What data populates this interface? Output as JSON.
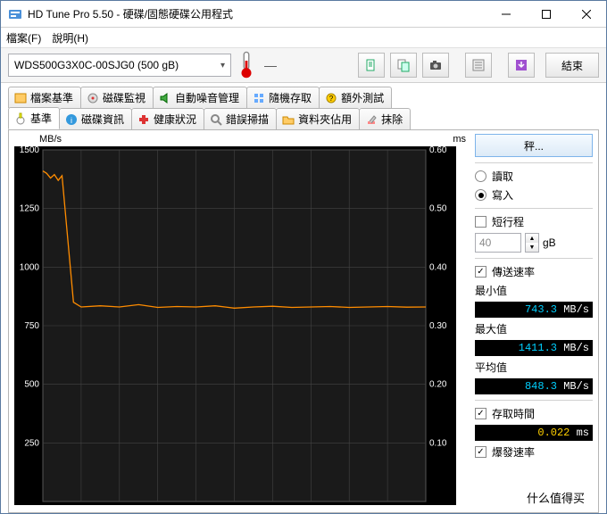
{
  "window": {
    "title": "HD Tune Pro 5.50 - 硬碟/固態硬碟公用程式"
  },
  "menu": {
    "file": "檔案(F)",
    "help": "說明(H)"
  },
  "toolbar": {
    "drive": "WDS500G3X0C-00SJG0 (500 gB)",
    "temp": "—",
    "exit": "結束"
  },
  "tabs_top": [
    {
      "label": "檔案基準"
    },
    {
      "label": "磁碟監視"
    },
    {
      "label": "自動噪音管理"
    },
    {
      "label": "隨機存取"
    },
    {
      "label": "額外測試"
    }
  ],
  "tabs_bottom": [
    {
      "label": "基準",
      "active": true
    },
    {
      "label": "磁碟資訊"
    },
    {
      "label": "健康狀況"
    },
    {
      "label": "錯誤掃描"
    },
    {
      "label": "資料夾佔用"
    },
    {
      "label": "抹除"
    }
  ],
  "chart_header": {
    "left": "MB/s",
    "right": "ms"
  },
  "chart_data": {
    "type": "line",
    "xlim": [
      0,
      100
    ],
    "y_left": {
      "label": "MB/s",
      "lim": [
        0,
        1500
      ],
      "ticks": [
        250,
        500,
        750,
        1000,
        1250,
        1500
      ]
    },
    "y_right": {
      "label": "ms",
      "lim": [
        0,
        0.6
      ],
      "ticks": [
        0.1,
        0.2,
        0.3,
        0.4,
        0.5,
        0.6
      ]
    },
    "series": [
      {
        "name": "transfer_rate_MBps",
        "axis": "left",
        "color": "#ff8c00",
        "x": [
          0,
          1,
          2,
          3,
          4,
          5,
          8,
          10,
          15,
          20,
          25,
          30,
          35,
          40,
          45,
          50,
          55,
          60,
          65,
          70,
          75,
          80,
          85,
          90,
          95,
          100
        ],
        "values": [
          1410,
          1400,
          1380,
          1395,
          1370,
          1390,
          850,
          830,
          835,
          830,
          840,
          828,
          832,
          830,
          835,
          825,
          830,
          833,
          828,
          830,
          832,
          828,
          830,
          832,
          829,
          830
        ]
      }
    ]
  },
  "side": {
    "run": "秤...",
    "read": "讀取",
    "write": "寫入",
    "short_stroke": "短行程",
    "short_stroke_value": "40",
    "short_stroke_unit": "gB",
    "transfer_rate": "傳送速率",
    "min_label": "最小值",
    "min_value": "743.3",
    "max_label": "最大值",
    "max_value": "1411.3",
    "avg_label": "平均值",
    "avg_value": "848.3",
    "rate_unit": "MB/s",
    "access_label": "存取時間",
    "access_value": "0.022",
    "access_unit": "ms",
    "burst_label": "爆發速率"
  },
  "watermark": "什么值得买"
}
